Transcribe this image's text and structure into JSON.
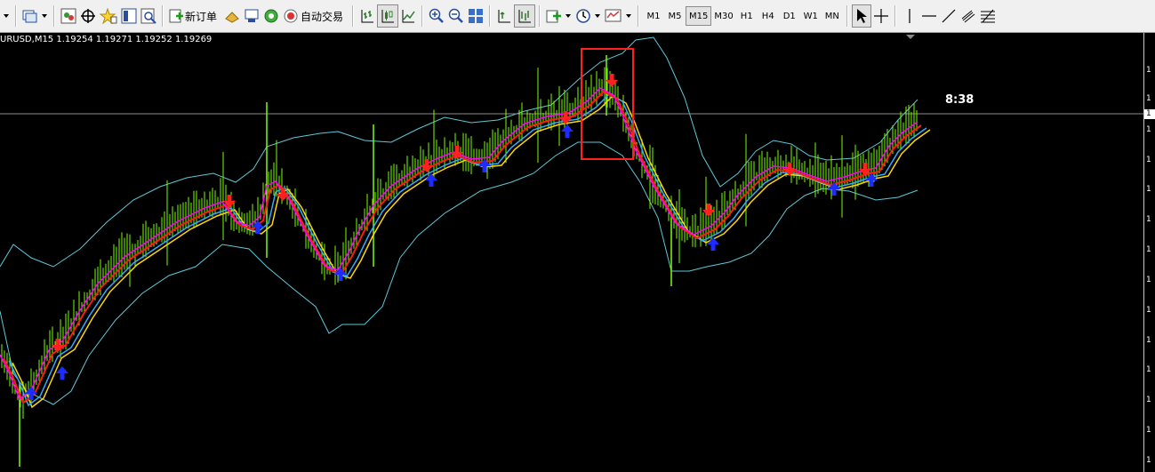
{
  "toolbar": {
    "new_order_label": "新订单",
    "auto_trading_label": "自动交易",
    "timeframes": [
      "M1",
      "M5",
      "M15",
      "M30",
      "H1",
      "H4",
      "D1",
      "W1",
      "MN"
    ],
    "active_timeframe": "M15"
  },
  "chart": {
    "info_line": "URUSD,M15  1.19254 1.19271 1.19252 1.19269",
    "countdown": "8:38",
    "price_axis_glyph": "1",
    "colors": {
      "candles": "#7CFC00",
      "bands": "#5fc8d8",
      "ma_fast": "#ff00ff",
      "ma_mid": "#ff1a1a",
      "ma_slow": "#ffd700",
      "ma_light": "#33aaff",
      "arrow_up": "#1e2bff",
      "arrow_down": "#ff2020",
      "highlight_box": "#ff2020"
    }
  }
}
